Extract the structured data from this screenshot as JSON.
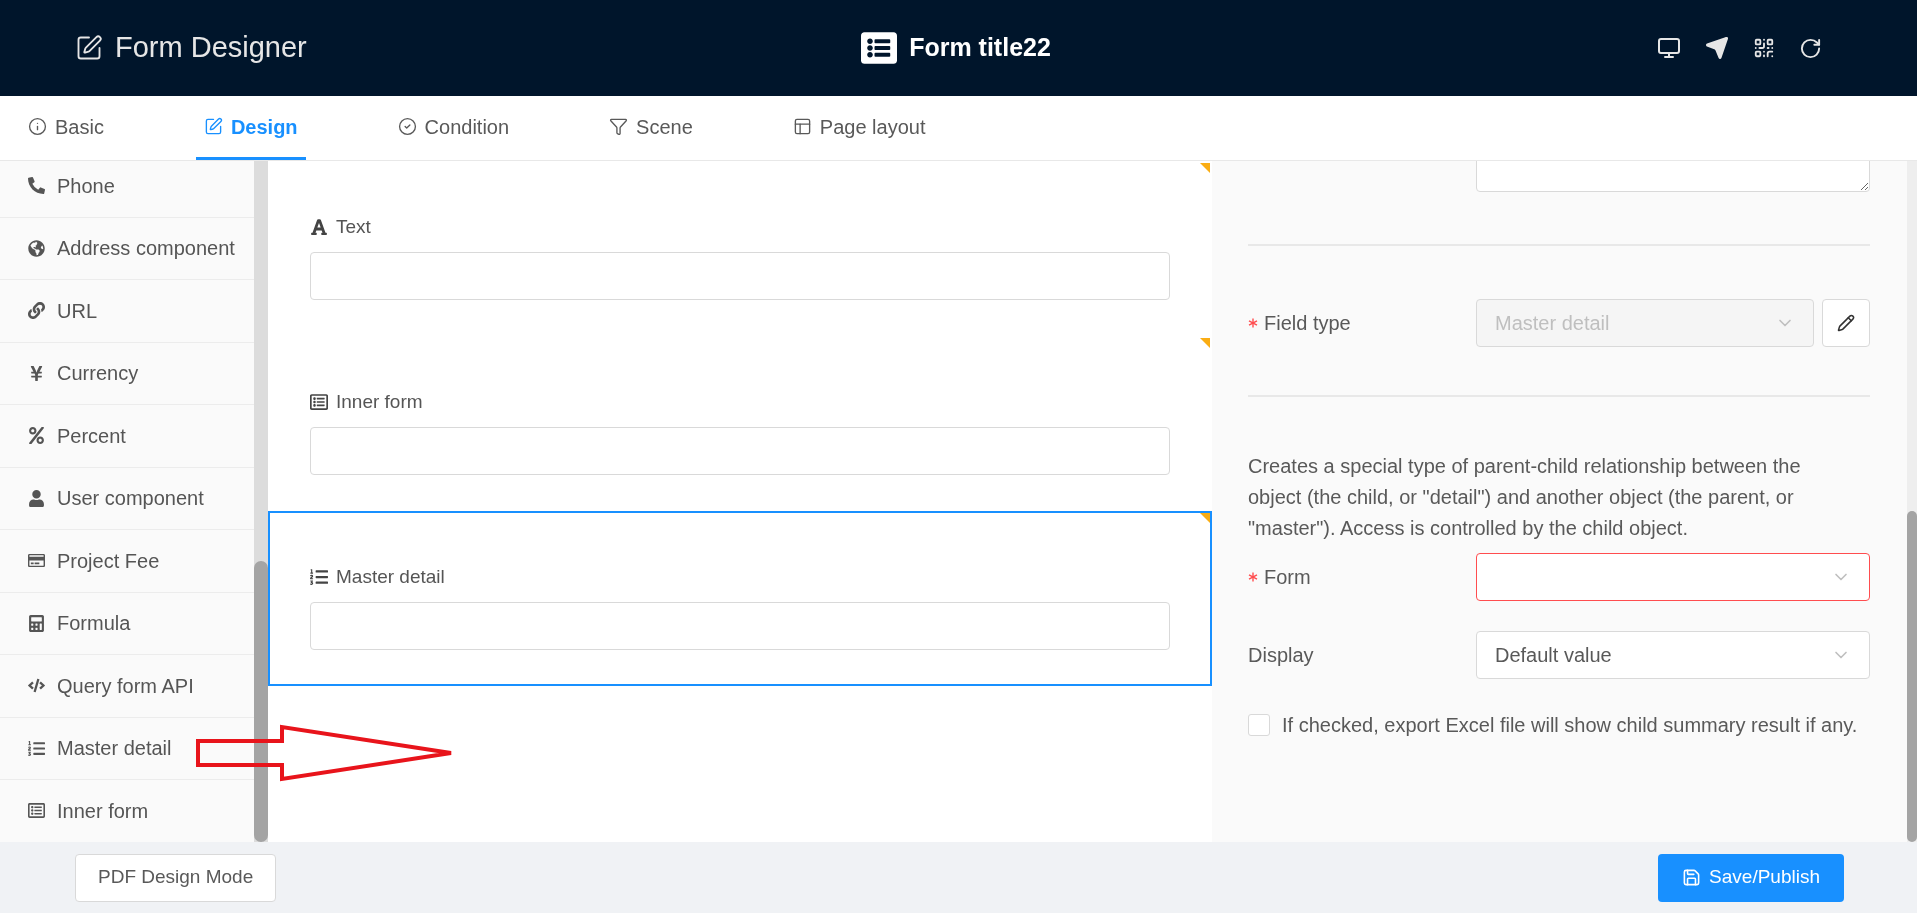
{
  "header": {
    "title": "Form Designer",
    "form_title": "Form title22"
  },
  "tabs": [
    {
      "label": "Basic",
      "selected": false
    },
    {
      "label": "Design",
      "selected": true
    },
    {
      "label": "Condition",
      "selected": false
    },
    {
      "label": "Scene",
      "selected": false
    },
    {
      "label": "Page layout",
      "selected": false
    }
  ],
  "sidebar": {
    "items": [
      "Phone",
      "Address component",
      "URL",
      "Currency",
      "Percent",
      "User component",
      "Project Fee",
      "Formula",
      "Query form API",
      "Master detail",
      "Inner form"
    ]
  },
  "canvas": {
    "fields": [
      {
        "label": "Text",
        "selected": false
      },
      {
        "label": "Inner form",
        "selected": false
      },
      {
        "label": "Master detail",
        "selected": true
      }
    ]
  },
  "properties": {
    "field_type": {
      "label": "Field type",
      "required": true,
      "value": "Master detail",
      "disabled": true
    },
    "help_text": "Creates a special type of parent-child relationship between the object (the child, or \"detail\") and another object (the parent, or \"master\"). Access is controlled by the child object.",
    "form": {
      "label": "Form",
      "required": true,
      "error": true
    },
    "display": {
      "label": "Display",
      "required": false,
      "value": "Default value"
    },
    "export_option": {
      "label": "If checked, export Excel file will show child summary result if any.",
      "checked": false
    }
  },
  "footer": {
    "left_button": "PDF Design Mode",
    "save_button": "Save/Publish"
  }
}
